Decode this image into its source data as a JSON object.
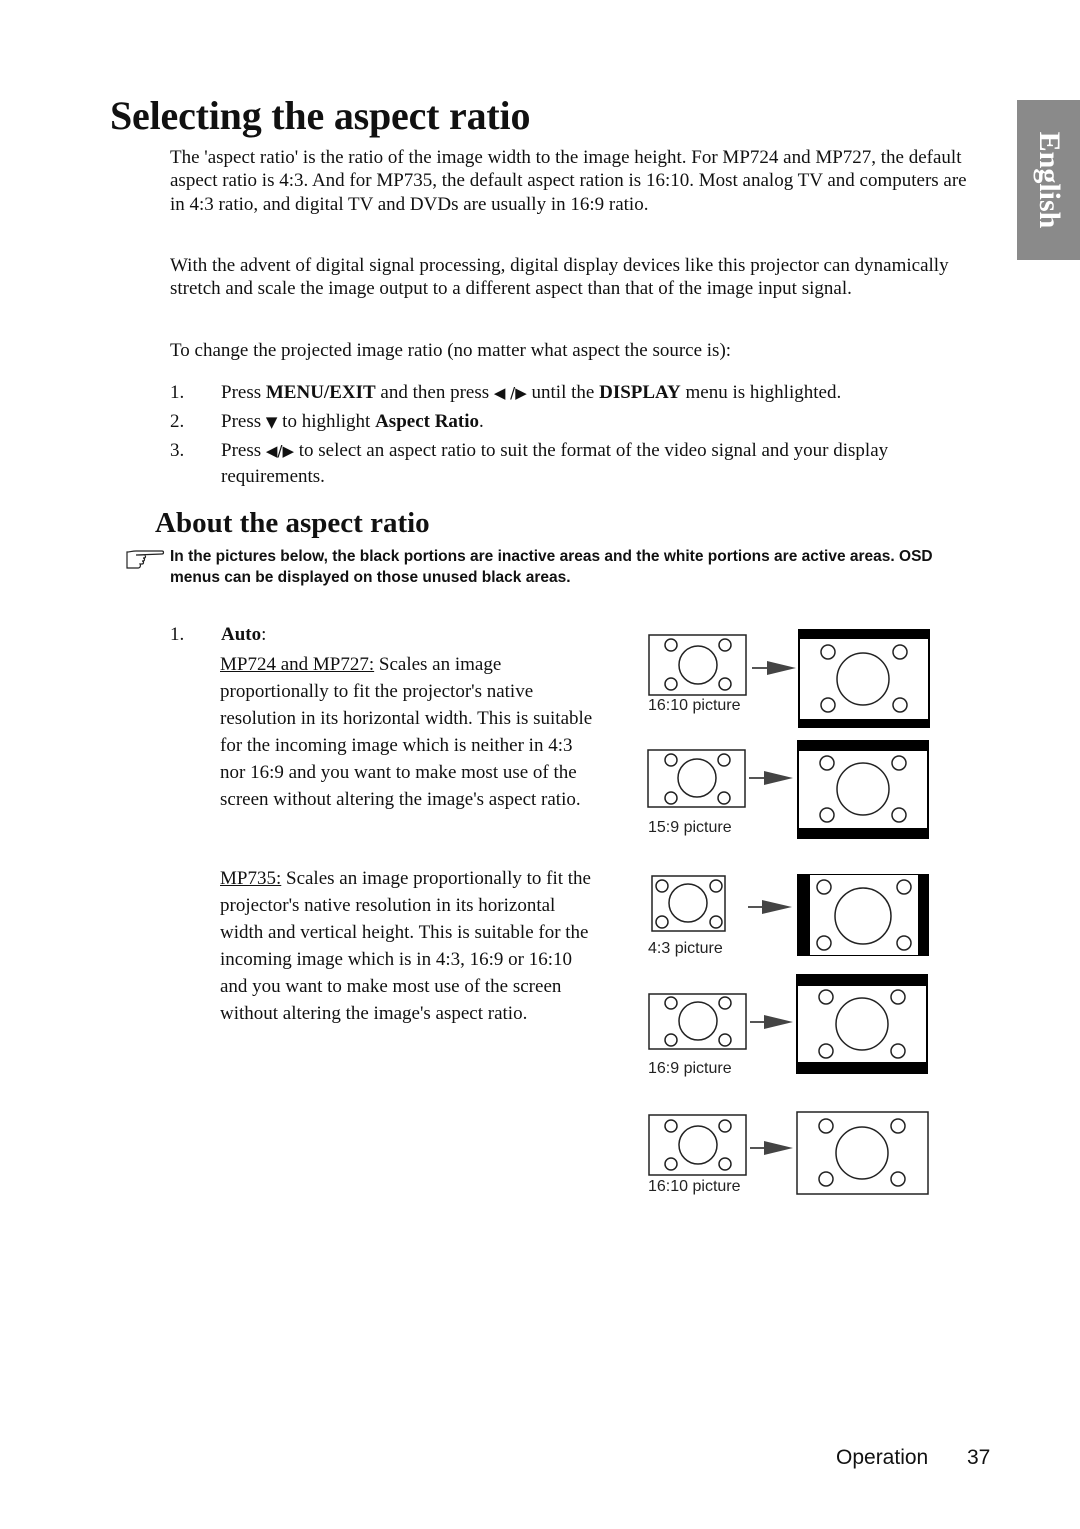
{
  "page": {
    "title": "Selecting the aspect ratio",
    "language_tab": "English",
    "intro_paragraphs": [
      "The 'aspect ratio' is the ratio of the image width to the image height. For MP724 and MP727, the default aspect ratio is 4:3. And for MP735, the default aspect ration is 16:10. Most analog TV and computers are in 4:3 ratio, and digital TV and DVDs are usually in 16:9 ratio.",
      "With the advent of digital signal processing, digital display devices like this projector can dynamically stretch and scale the image output to a different aspect than that of the image input signal.",
      "To change the projected image ratio (no matter what aspect the source is):"
    ],
    "steps": [
      {
        "num": "1.",
        "pre": "Press ",
        "b1": "MENU/EXIT",
        "mid": " and then press ",
        "arrows": "◀ /▶",
        "mid2": " until the ",
        "b2": "DISPLAY",
        "post": " menu is highlighted."
      },
      {
        "num": "2.",
        "pre": "Press ",
        "arrows": "▼",
        "mid": " to highlight ",
        "b1": "Aspect Ratio",
        "post": "."
      },
      {
        "num": "3.",
        "pre": "Press ",
        "arrows": "◀/▶",
        "post": " to select an aspect ratio to suit the format of the video signal and your display requirements."
      }
    ],
    "subtitle": "About the aspect ratio",
    "note_icon": "pointing-hand-icon",
    "note": "In the pictures below, the black portions are inactive areas and the white portions are active areas. OSD menus can be displayed on those unused black areas.",
    "auto": {
      "num": "1.",
      "label": "Auto",
      "colon": ":",
      "models_a": "MP724 and MP727:",
      "desc_a": " Scales an image proportionally to fit the projector's native resolution in its horizontal width. This is suitable for the incoming image which is neither in 4:3 nor 16:9 and you want to make most use of the screen without altering the image's aspect ratio.",
      "models_b": "MP735:",
      "desc_b": " Scales an image proportionally to fit the projector's native resolution in its horizontal width and vertical height. This is suitable for the incoming image which is in 4:3, 16:9 or 16:10 and you want to make most use of the screen without altering the image's aspect ratio."
    },
    "diagrams": [
      {
        "caption": "16:10 picture",
        "result": "letterbox"
      },
      {
        "caption": "15:9 picture",
        "result": "letterbox"
      },
      {
        "caption": "4:3 picture",
        "result": "pillarbox"
      },
      {
        "caption": "16:9 picture",
        "result": "letterbox"
      },
      {
        "caption": "16:10 picture",
        "result": "full"
      }
    ],
    "footer": {
      "section": "Operation",
      "page_number": "37"
    }
  }
}
